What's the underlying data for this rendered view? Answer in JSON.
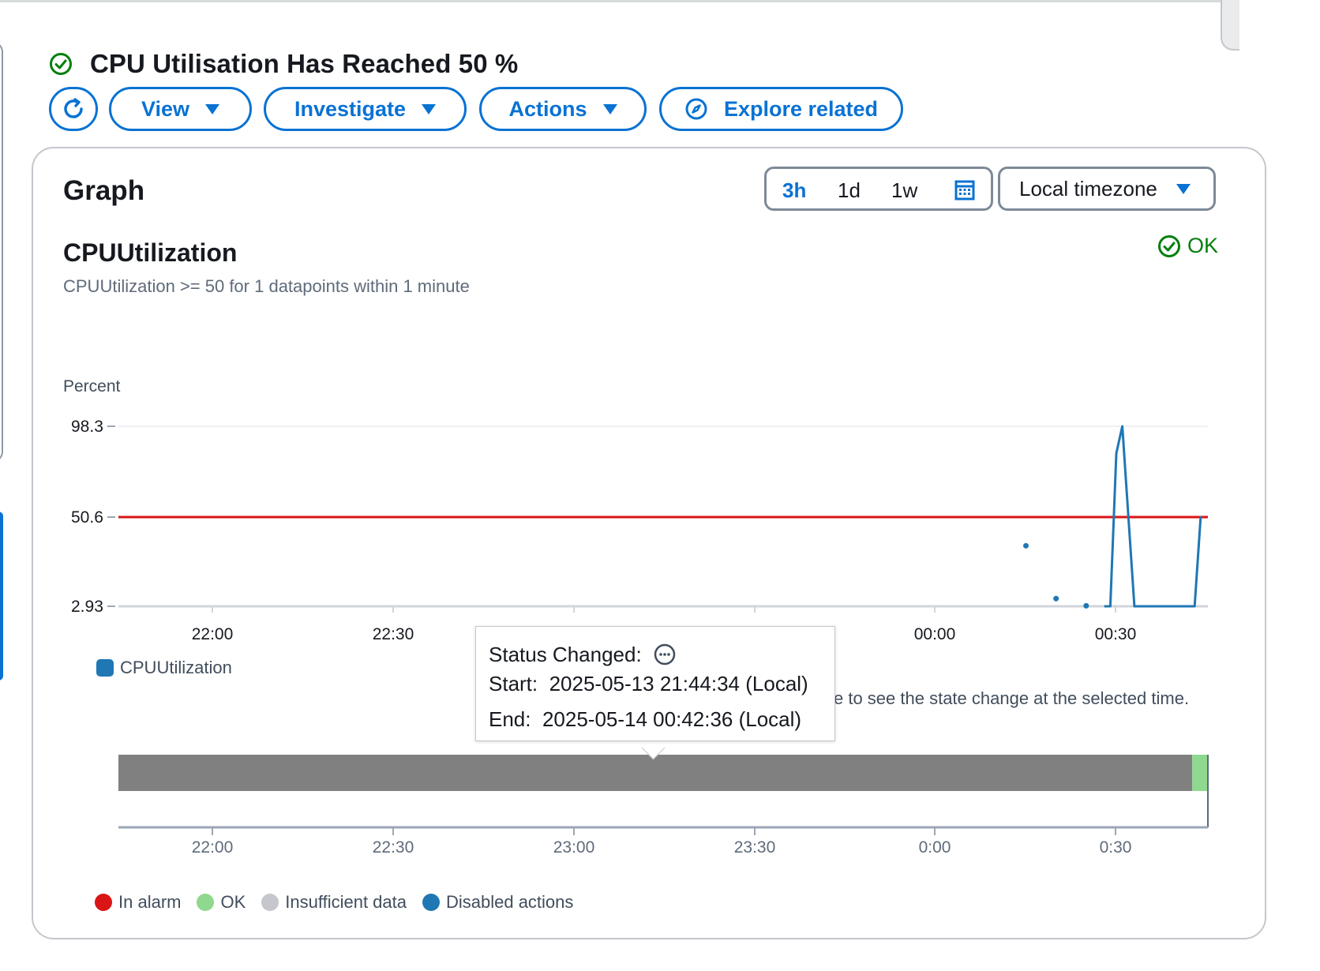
{
  "header": {
    "title": "CPU Utilisation Has Reached 50 %",
    "buttons": {
      "view": "View",
      "investigate": "Investigate",
      "actions": "Actions",
      "explore_related": "Explore related"
    }
  },
  "graph": {
    "heading": "Graph",
    "ranges": [
      "3h",
      "1d",
      "1w"
    ],
    "active_range": "3h",
    "timezone": "Local timezone",
    "metric_title": "CPUUtilization",
    "metric_condition": "CPUUtilization >= 50 for 1 datapoints within 1 minute",
    "status": "OK",
    "hint": "e to see the state change at the selected time."
  },
  "tooltip": {
    "title": "Status Changed:",
    "start_label": "Start:",
    "start_value": "2025-05-13 21:44:34 (Local)",
    "end_label": "End:",
    "end_value": "2025-05-14 00:42:36 (Local)"
  },
  "chart_data": [
    {
      "type": "line",
      "ylabel": "Percent",
      "y_ticks": [
        "98.3",
        "50.6",
        "2.93"
      ],
      "x_ticks": [
        "22:00",
        "22:30",
        "00:00",
        "00:30"
      ],
      "ylim": [
        2.93,
        98.3
      ],
      "threshold": {
        "value": 50.6,
        "color": "#d91515"
      },
      "series": [
        {
          "name": "CPUUtilization",
          "color": "#1f77b4",
          "points": [
            {
              "x": "00:15",
              "y": 35
            },
            {
              "x": "00:20",
              "y": 7
            },
            {
              "x": "00:25",
              "y": 3.2
            }
          ],
          "line": [
            {
              "x": "00:28",
              "y": 2.93
            },
            {
              "x": "00:29",
              "y": 2.93
            },
            {
              "x": "00:30",
              "y": 84
            },
            {
              "x": "00:31",
              "y": 98.3
            },
            {
              "x": "00:33",
              "y": 2.93
            },
            {
              "x": "00:43",
              "y": 2.93
            },
            {
              "x": "00:44",
              "y": 50.6
            }
          ]
        }
      ]
    },
    {
      "type": "timeline",
      "x_ticks": [
        "22:00",
        "22:30",
        "23:00",
        "23:30",
        "0:00",
        "0:30"
      ],
      "states": [
        {
          "state": "Insufficient data",
          "from": "21:44:34",
          "to": "00:42:36",
          "color": "#808080"
        },
        {
          "state": "OK",
          "from": "00:42:36",
          "to": "00:45",
          "color": "#8fd88f"
        }
      ]
    }
  ],
  "legend_states": [
    {
      "label": "In alarm",
      "color": "#d91515"
    },
    {
      "label": "OK",
      "color": "#8fd88f"
    },
    {
      "label": "Insufficient data",
      "color": "#c6c6cd"
    },
    {
      "label": "Disabled actions",
      "color": "#1f77b4"
    }
  ]
}
